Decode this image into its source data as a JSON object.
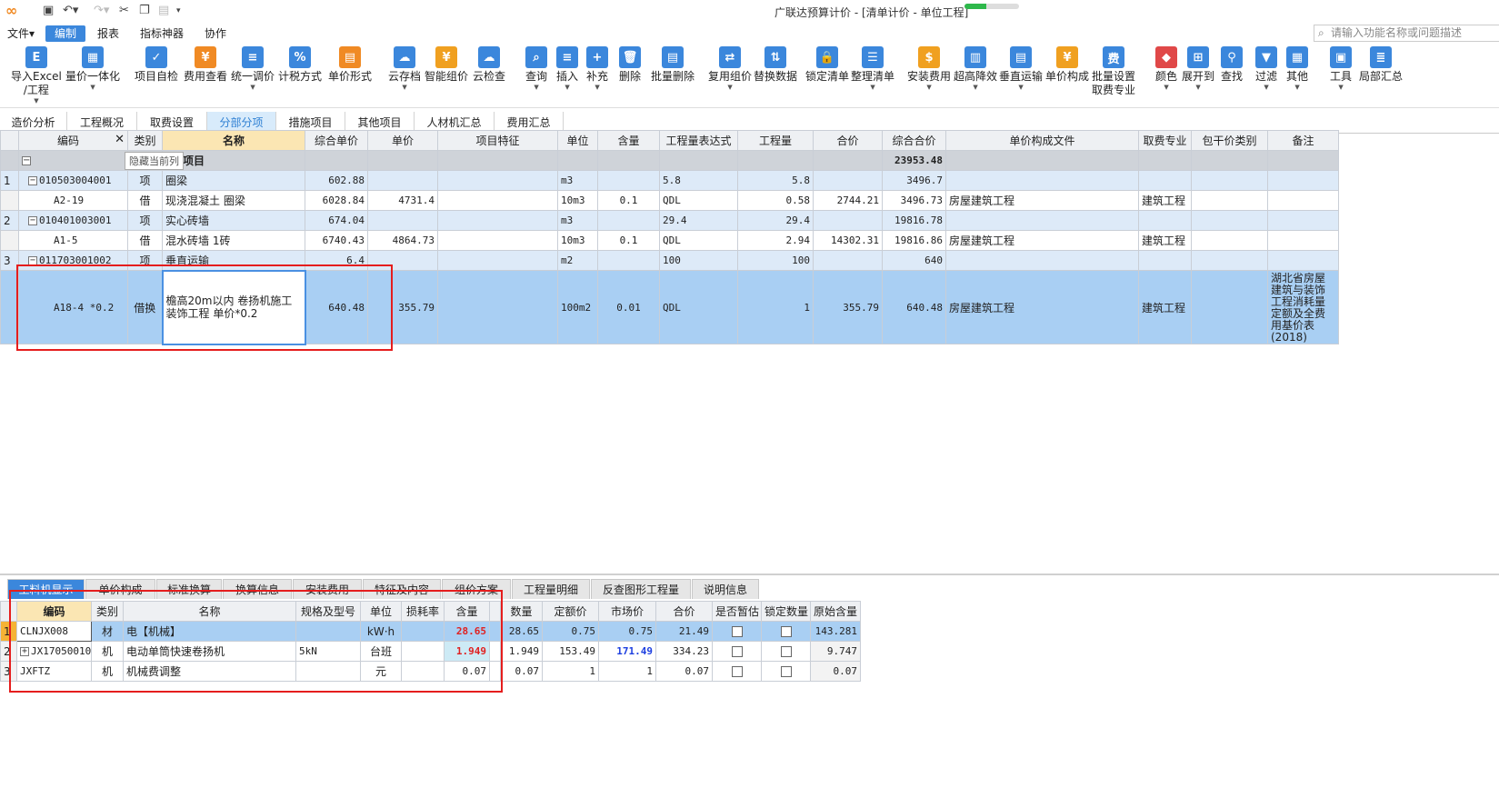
{
  "titlebar": {
    "title": "广联达预算计价 - [清单计价 - 单位工程]",
    "progress": 0.4
  },
  "menu": [
    "文件▾",
    "编制",
    "报表",
    "指标神器",
    "协作"
  ],
  "search": {
    "placeholder": "请输入功能名称或问题描述"
  },
  "ribbon": [
    {
      "label": "导入Excel",
      "label2": "/工程",
      "icon": "import-excel-icon",
      "color": "#3b87dc"
    },
    {
      "label": "量价一体化",
      "icon": "quantity-price-icon",
      "color": "#3b87dc"
    },
    {
      "label": "项目自检",
      "icon": "project-check-icon",
      "color": "#3b87dc"
    },
    {
      "label": "费用查看",
      "icon": "fee-view-icon",
      "color": "#f08a24"
    },
    {
      "label": "统一调价",
      "icon": "unified-price-icon",
      "color": "#3b87dc"
    },
    {
      "label": "计税方式",
      "icon": "tax-method-icon",
      "color": "#3b87dc"
    },
    {
      "label": "单价形式",
      "icon": "unit-price-form-icon",
      "color": "#f08a24"
    },
    {
      "label": "云存档",
      "icon": "cloud-archive-icon",
      "color": "#3b87dc"
    },
    {
      "label": "智能组价",
      "icon": "smart-pricing-icon",
      "color": "#f0a020"
    },
    {
      "label": "云检查",
      "icon": "cloud-check-icon",
      "color": "#3b87dc"
    },
    {
      "label": "查询",
      "icon": "query-icon",
      "color": "#3b87dc"
    },
    {
      "label": "插入",
      "icon": "insert-icon",
      "color": "#3b87dc"
    },
    {
      "label": "补充",
      "icon": "supplement-icon",
      "color": "#3b87dc"
    },
    {
      "label": "删除",
      "icon": "delete-icon",
      "color": "#3b87dc"
    },
    {
      "label": "批量删除",
      "icon": "batch-delete-icon",
      "color": "#3b87dc"
    },
    {
      "label": "复用组价",
      "icon": "reuse-pricing-icon",
      "color": "#3b87dc"
    },
    {
      "label": "替换数据",
      "icon": "replace-data-icon",
      "color": "#3b87dc"
    },
    {
      "label": "锁定清单",
      "icon": "lock-list-icon",
      "color": "#3b87dc"
    },
    {
      "label": "整理清单",
      "icon": "organize-list-icon",
      "color": "#3b87dc"
    },
    {
      "label": "安装费用",
      "icon": "install-fee-icon",
      "color": "#f0a020"
    },
    {
      "label": "超高降效",
      "icon": "super-height-icon",
      "color": "#3b87dc"
    },
    {
      "label": "垂直运输",
      "icon": "vertical-transport-icon",
      "color": "#3b87dc"
    },
    {
      "label": "单价构成",
      "icon": "unit-price-composition-icon",
      "color": "#f0a020"
    },
    {
      "label": "批量设置",
      "label2": "取费专业",
      "icon": "batch-setting-icon",
      "color": "#3b87dc"
    },
    {
      "label": "颜色",
      "icon": "color-icon",
      "color": "#e04848"
    },
    {
      "label": "展开到",
      "icon": "expand-to-icon",
      "color": "#3b87dc"
    },
    {
      "label": "查找",
      "icon": "find-icon",
      "color": "#3b87dc"
    },
    {
      "label": "过滤",
      "icon": "filter-icon",
      "color": "#3b87dc"
    },
    {
      "label": "其他",
      "icon": "other-icon",
      "color": "#3b87dc"
    },
    {
      "label": "工具",
      "icon": "tool-icon",
      "color": "#3b87dc"
    },
    {
      "label": "局部汇总",
      "icon": "partial-summary-icon",
      "color": "#3b87dc"
    }
  ],
  "pagetabs": [
    "造价分析",
    "工程概况",
    "取费设置",
    "分部分项",
    "措施项目",
    "其他项目",
    "人材机汇总",
    "费用汇总"
  ],
  "main_grid": {
    "headers": [
      "编码",
      "类别",
      "名称",
      "综合单价",
      "单价",
      "项目特征",
      "单位",
      "含量",
      "工程量表达式",
      "工程量",
      "合价",
      "综合合价",
      "单价构成文件",
      "取费专业",
      "包干价类别",
      "备注"
    ],
    "tooltip": "隐藏当前列",
    "group": {
      "name": "项目",
      "total": "23953.48"
    },
    "rows": [
      {
        "rn": "1",
        "code": "010503004001",
        "type": "项",
        "name": "圈梁",
        "cprice": "602.88",
        "price": "",
        "unit": "m3",
        "qty": "",
        "expr": "5.8",
        "amount": "5.8",
        "total": "",
        "ctotal": "3496.7",
        "file": "",
        "spec": ""
      },
      {
        "rn": "",
        "code": "A2-19",
        "type": "借",
        "name": "现浇混凝土 圈梁",
        "cprice": "6028.84",
        "price": "4731.4",
        "unit": "10m3",
        "qty": "0.1",
        "expr": "QDL",
        "amount": "0.58",
        "total": "2744.21",
        "ctotal": "3496.73",
        "file": "房屋建筑工程",
        "spec": "建筑工程"
      },
      {
        "rn": "2",
        "code": "010401003001",
        "type": "项",
        "name": "实心砖墙",
        "cprice": "674.04",
        "price": "",
        "unit": "m3",
        "qty": "",
        "expr": "29.4",
        "amount": "29.4",
        "total": "",
        "ctotal": "19816.78",
        "file": "",
        "spec": ""
      },
      {
        "rn": "",
        "code": "A1-5",
        "type": "借",
        "name": "混水砖墙 1砖",
        "cprice": "6740.43",
        "price": "4864.73",
        "unit": "10m3",
        "qty": "0.1",
        "expr": "QDL",
        "amount": "2.94",
        "total": "14302.31",
        "ctotal": "19816.86",
        "file": "房屋建筑工程",
        "spec": "建筑工程"
      },
      {
        "rn": "3",
        "code": "011703001002",
        "type": "项",
        "name": "垂直运输",
        "cprice": "6.4",
        "price": "",
        "unit": "m2",
        "qty": "",
        "expr": "100",
        "amount": "100",
        "total": "",
        "ctotal": "640",
        "file": "",
        "spec": ""
      },
      {
        "rn": "",
        "code": "A18-4 *0.2",
        "type": "借换",
        "name": "檐高20m以内 卷扬机施工  装饰工程 单价*0.2",
        "cprice": "640.48",
        "price": "355.79",
        "unit": "100m2",
        "qty": "0.01",
        "expr": "QDL",
        "amount": "1",
        "total": "355.79",
        "ctotal": "640.48",
        "file": "房屋建筑工程",
        "spec": "建筑工程",
        "remark": "湖北省房屋建筑与装饰工程消耗量定额及全费用基价表(2018)"
      }
    ]
  },
  "bottomtabs": [
    "工料机显示",
    "单价构成",
    "标准换算",
    "换算信息",
    "安装费用",
    "特征及内容",
    "组价方案",
    "工程量明细",
    "反查图形工程量",
    "说明信息"
  ],
  "bottom_grid": {
    "headers": [
      "编码",
      "类别",
      "名称",
      "规格及型号",
      "单位",
      "损耗率",
      "含量",
      "数量",
      "定额价",
      "市场价",
      "合价",
      "是否暂估",
      "锁定数量",
      "原始含量"
    ],
    "rows": [
      {
        "rn": "1",
        "code": "CLNJX008",
        "type": "材",
        "name": "电【机械】",
        "spec": "",
        "unit": "kW·h",
        "loss": "",
        "qty": "28.65",
        "num": "28.65",
        "dprice": "0.75",
        "mprice": "0.75",
        "total": "21.49",
        "orig": "143.281"
      },
      {
        "rn": "2",
        "code": "JX17050010",
        "type": "机",
        "name": "电动单筒快速卷扬机",
        "spec": "5kN",
        "unit": "台班",
        "loss": "",
        "qty": "1.949",
        "num": "1.949",
        "dprice": "153.49",
        "mprice": "171.49",
        "total": "334.23",
        "orig": "9.747"
      },
      {
        "rn": "3",
        "code": "JXFTZ",
        "type": "机",
        "name": "机械费调整",
        "spec": "",
        "unit": "元",
        "loss": "",
        "qty": "0.07",
        "num": "0.07",
        "dprice": "1",
        "mprice": "1",
        "total": "0.07",
        "orig": "0.07"
      }
    ]
  },
  "colors": {
    "accent": "#3b87dc",
    "highlight_box": "#e51d1d",
    "selected_row": "#a9cff3",
    "list_row": "#ddeaf8"
  }
}
